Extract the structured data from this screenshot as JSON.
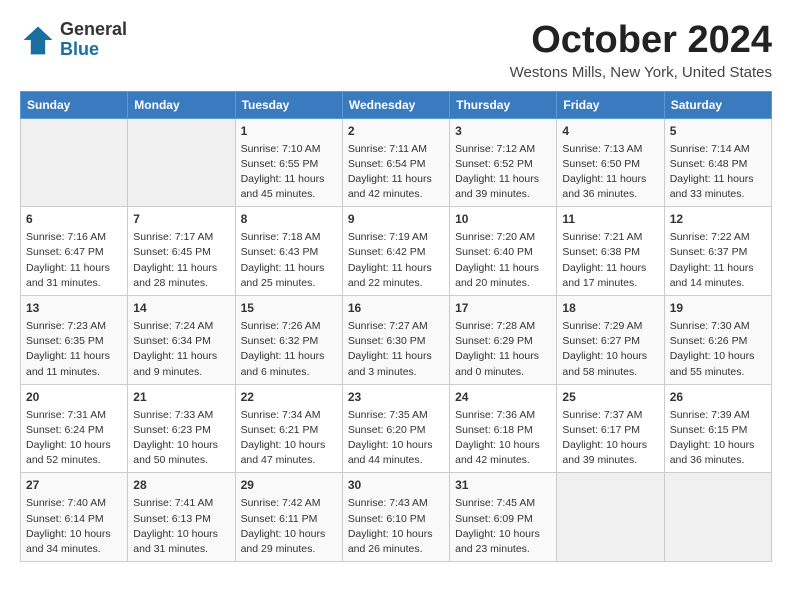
{
  "logo": {
    "general": "General",
    "blue": "Blue"
  },
  "title": {
    "month_year": "October 2024",
    "location": "Westons Mills, New York, United States"
  },
  "headers": [
    "Sunday",
    "Monday",
    "Tuesday",
    "Wednesday",
    "Thursday",
    "Friday",
    "Saturday"
  ],
  "weeks": [
    [
      {
        "day": "",
        "empty": true
      },
      {
        "day": "",
        "empty": true
      },
      {
        "day": "1",
        "sunrise": "Sunrise: 7:10 AM",
        "sunset": "Sunset: 6:55 PM",
        "daylight": "Daylight: 11 hours and 45 minutes."
      },
      {
        "day": "2",
        "sunrise": "Sunrise: 7:11 AM",
        "sunset": "Sunset: 6:54 PM",
        "daylight": "Daylight: 11 hours and 42 minutes."
      },
      {
        "day": "3",
        "sunrise": "Sunrise: 7:12 AM",
        "sunset": "Sunset: 6:52 PM",
        "daylight": "Daylight: 11 hours and 39 minutes."
      },
      {
        "day": "4",
        "sunrise": "Sunrise: 7:13 AM",
        "sunset": "Sunset: 6:50 PM",
        "daylight": "Daylight: 11 hours and 36 minutes."
      },
      {
        "day": "5",
        "sunrise": "Sunrise: 7:14 AM",
        "sunset": "Sunset: 6:48 PM",
        "daylight": "Daylight: 11 hours and 33 minutes."
      }
    ],
    [
      {
        "day": "6",
        "sunrise": "Sunrise: 7:16 AM",
        "sunset": "Sunset: 6:47 PM",
        "daylight": "Daylight: 11 hours and 31 minutes."
      },
      {
        "day": "7",
        "sunrise": "Sunrise: 7:17 AM",
        "sunset": "Sunset: 6:45 PM",
        "daylight": "Daylight: 11 hours and 28 minutes."
      },
      {
        "day": "8",
        "sunrise": "Sunrise: 7:18 AM",
        "sunset": "Sunset: 6:43 PM",
        "daylight": "Daylight: 11 hours and 25 minutes."
      },
      {
        "day": "9",
        "sunrise": "Sunrise: 7:19 AM",
        "sunset": "Sunset: 6:42 PM",
        "daylight": "Daylight: 11 hours and 22 minutes."
      },
      {
        "day": "10",
        "sunrise": "Sunrise: 7:20 AM",
        "sunset": "Sunset: 6:40 PM",
        "daylight": "Daylight: 11 hours and 20 minutes."
      },
      {
        "day": "11",
        "sunrise": "Sunrise: 7:21 AM",
        "sunset": "Sunset: 6:38 PM",
        "daylight": "Daylight: 11 hours and 17 minutes."
      },
      {
        "day": "12",
        "sunrise": "Sunrise: 7:22 AM",
        "sunset": "Sunset: 6:37 PM",
        "daylight": "Daylight: 11 hours and 14 minutes."
      }
    ],
    [
      {
        "day": "13",
        "sunrise": "Sunrise: 7:23 AM",
        "sunset": "Sunset: 6:35 PM",
        "daylight": "Daylight: 11 hours and 11 minutes."
      },
      {
        "day": "14",
        "sunrise": "Sunrise: 7:24 AM",
        "sunset": "Sunset: 6:34 PM",
        "daylight": "Daylight: 11 hours and 9 minutes."
      },
      {
        "day": "15",
        "sunrise": "Sunrise: 7:26 AM",
        "sunset": "Sunset: 6:32 PM",
        "daylight": "Daylight: 11 hours and 6 minutes."
      },
      {
        "day": "16",
        "sunrise": "Sunrise: 7:27 AM",
        "sunset": "Sunset: 6:30 PM",
        "daylight": "Daylight: 11 hours and 3 minutes."
      },
      {
        "day": "17",
        "sunrise": "Sunrise: 7:28 AM",
        "sunset": "Sunset: 6:29 PM",
        "daylight": "Daylight: 11 hours and 0 minutes."
      },
      {
        "day": "18",
        "sunrise": "Sunrise: 7:29 AM",
        "sunset": "Sunset: 6:27 PM",
        "daylight": "Daylight: 10 hours and 58 minutes."
      },
      {
        "day": "19",
        "sunrise": "Sunrise: 7:30 AM",
        "sunset": "Sunset: 6:26 PM",
        "daylight": "Daylight: 10 hours and 55 minutes."
      }
    ],
    [
      {
        "day": "20",
        "sunrise": "Sunrise: 7:31 AM",
        "sunset": "Sunset: 6:24 PM",
        "daylight": "Daylight: 10 hours and 52 minutes."
      },
      {
        "day": "21",
        "sunrise": "Sunrise: 7:33 AM",
        "sunset": "Sunset: 6:23 PM",
        "daylight": "Daylight: 10 hours and 50 minutes."
      },
      {
        "day": "22",
        "sunrise": "Sunrise: 7:34 AM",
        "sunset": "Sunset: 6:21 PM",
        "daylight": "Daylight: 10 hours and 47 minutes."
      },
      {
        "day": "23",
        "sunrise": "Sunrise: 7:35 AM",
        "sunset": "Sunset: 6:20 PM",
        "daylight": "Daylight: 10 hours and 44 minutes."
      },
      {
        "day": "24",
        "sunrise": "Sunrise: 7:36 AM",
        "sunset": "Sunset: 6:18 PM",
        "daylight": "Daylight: 10 hours and 42 minutes."
      },
      {
        "day": "25",
        "sunrise": "Sunrise: 7:37 AM",
        "sunset": "Sunset: 6:17 PM",
        "daylight": "Daylight: 10 hours and 39 minutes."
      },
      {
        "day": "26",
        "sunrise": "Sunrise: 7:39 AM",
        "sunset": "Sunset: 6:15 PM",
        "daylight": "Daylight: 10 hours and 36 minutes."
      }
    ],
    [
      {
        "day": "27",
        "sunrise": "Sunrise: 7:40 AM",
        "sunset": "Sunset: 6:14 PM",
        "daylight": "Daylight: 10 hours and 34 minutes."
      },
      {
        "day": "28",
        "sunrise": "Sunrise: 7:41 AM",
        "sunset": "Sunset: 6:13 PM",
        "daylight": "Daylight: 10 hours and 31 minutes."
      },
      {
        "day": "29",
        "sunrise": "Sunrise: 7:42 AM",
        "sunset": "Sunset: 6:11 PM",
        "daylight": "Daylight: 10 hours and 29 minutes."
      },
      {
        "day": "30",
        "sunrise": "Sunrise: 7:43 AM",
        "sunset": "Sunset: 6:10 PM",
        "daylight": "Daylight: 10 hours and 26 minutes."
      },
      {
        "day": "31",
        "sunrise": "Sunrise: 7:45 AM",
        "sunset": "Sunset: 6:09 PM",
        "daylight": "Daylight: 10 hours and 23 minutes."
      },
      {
        "day": "",
        "empty": true
      },
      {
        "day": "",
        "empty": true
      }
    ]
  ]
}
